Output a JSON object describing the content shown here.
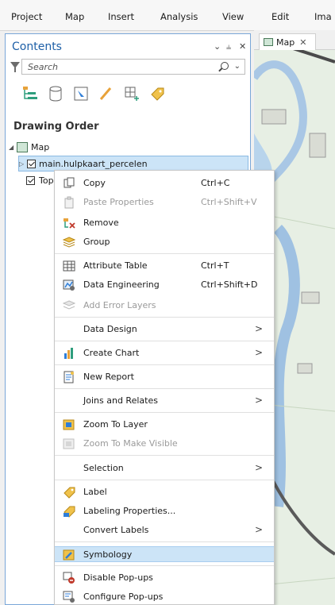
{
  "ribbon": {
    "tabs": [
      "Project",
      "Map",
      "Insert",
      "Analysis",
      "View",
      "Edit",
      "Ima"
    ]
  },
  "map_view": {
    "tab_label": "Map",
    "tab_close": "✕"
  },
  "contents": {
    "title": "Contents",
    "controls": {
      "menu": "⌄",
      "pin": "⫨",
      "close": "✕"
    },
    "search_placeholder": "Search",
    "section_title": "Drawing Order",
    "tree": {
      "map_label": "Map",
      "layer1": "main.hulpkaart_percelen",
      "layer2": "Top"
    }
  },
  "context_menu": {
    "copy": {
      "label": "Copy",
      "shortcut": "Ctrl+C"
    },
    "paste_properties": {
      "label": "Paste Properties",
      "shortcut": "Ctrl+Shift+V"
    },
    "remove": "Remove",
    "group": "Group",
    "attribute_table": {
      "label": "Attribute Table",
      "shortcut": "Ctrl+T"
    },
    "data_engineering": {
      "label": "Data Engineering",
      "shortcut": "Ctrl+Shift+D"
    },
    "add_error_layers": "Add Error Layers",
    "data_design": "Data Design",
    "create_chart": "Create Chart",
    "new_report": "New Report",
    "joins_and_relates": "Joins and Relates",
    "zoom_to_layer": "Zoom To Layer",
    "zoom_to_make_visible": "Zoom To Make Visible",
    "selection": "Selection",
    "label": "Label",
    "labeling_properties": "Labeling Properties...",
    "convert_labels": "Convert Labels",
    "symbology": "Symbology",
    "disable_popups": "Disable Pop-ups",
    "configure_popups": "Configure Pop-ups",
    "submenu_arrow": ">"
  }
}
